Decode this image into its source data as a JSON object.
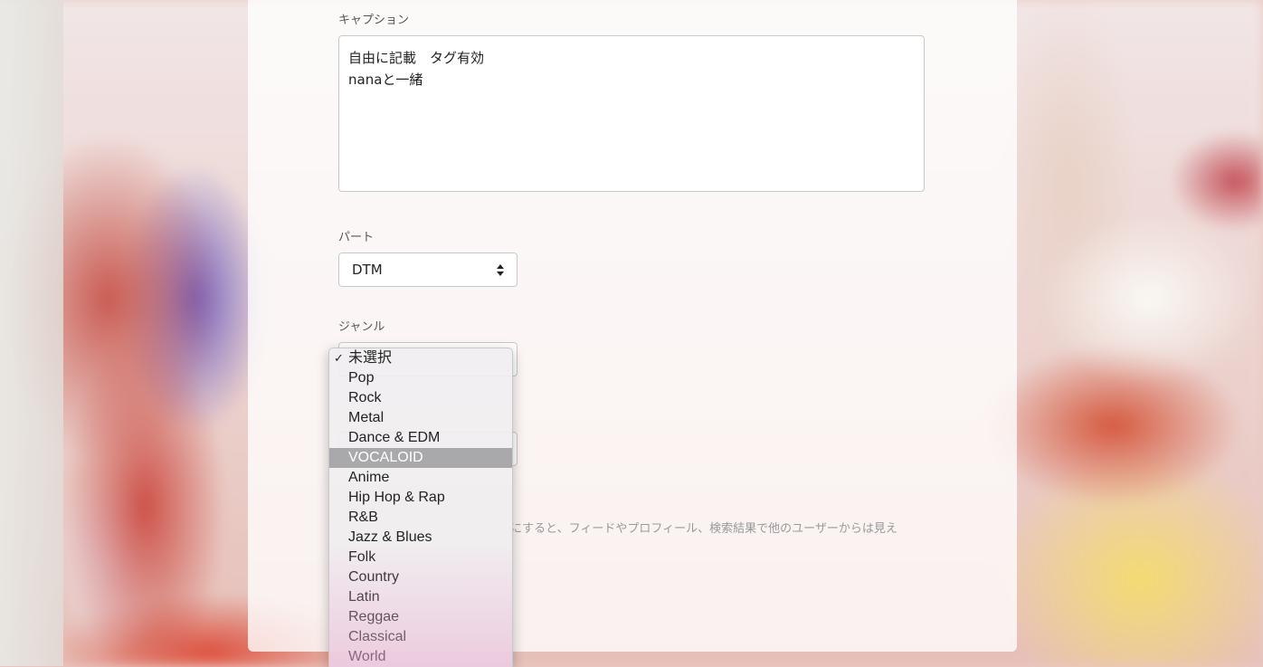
{
  "caption": {
    "label": "キャプション",
    "value": "自由に記載　タグ有効\nnanaと一緒"
  },
  "part": {
    "label": "パート",
    "selected": "DTM"
  },
  "genre": {
    "label": "ジャンル",
    "options": [
      {
        "label": "未選択",
        "checked": true
      },
      {
        "label": "Pop"
      },
      {
        "label": "Rock"
      },
      {
        "label": "Metal"
      },
      {
        "label": "Dance & EDM"
      },
      {
        "label": "VOCALOID",
        "highlighted": true
      },
      {
        "label": "Anime"
      },
      {
        "label": "Hip Hop & Rap"
      },
      {
        "label": "R&B"
      },
      {
        "label": "Jazz & Blues"
      },
      {
        "label": "Folk"
      },
      {
        "label": "Country"
      },
      {
        "label": "Latin"
      },
      {
        "label": "Reggae"
      },
      {
        "label": "Classical"
      },
      {
        "label": "World"
      }
    ],
    "check_mark": "✓"
  },
  "privacy_hint": "にすると、フィードやプロフィール、検索結果で他のユーザーからは見え",
  "colors": {
    "highlight": "#a9a8ab",
    "text": "#222222",
    "label": "#555555"
  }
}
